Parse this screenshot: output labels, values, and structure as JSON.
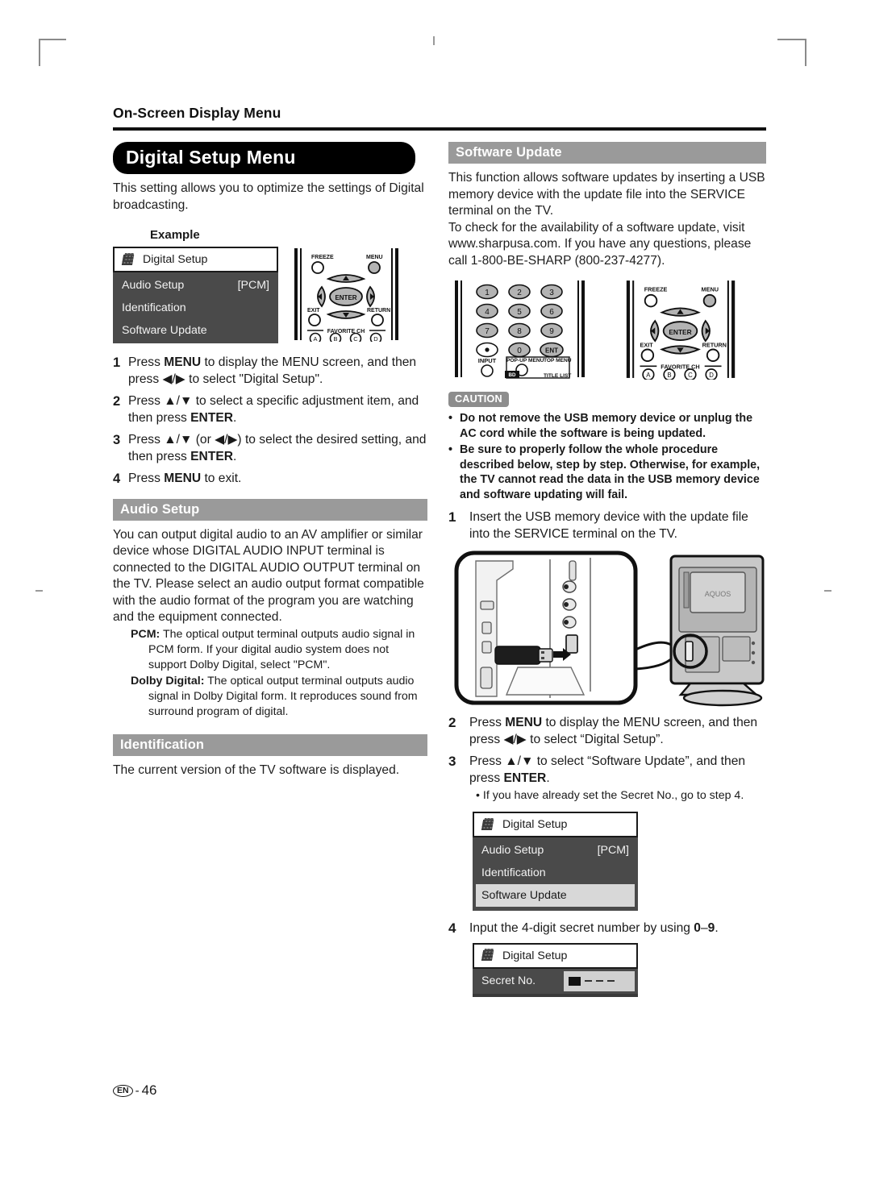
{
  "running_head": "On-Screen Display Menu",
  "page_title": "Digital Setup Menu",
  "intro": "This setting allows you to optimize the settings of Digital broadcasting.",
  "example_label": "Example",
  "osd_example": {
    "tab_label": "Digital Setup",
    "rows": [
      {
        "label": "Audio Setup",
        "value": "[PCM]"
      },
      {
        "label": "Identification",
        "value": ""
      },
      {
        "label": "Software Update",
        "value": ""
      }
    ]
  },
  "steps_left": [
    {
      "num": "1",
      "html": "Press <b>MENU</b> to display the MENU screen, and then press ◀/▶ to select \"Digital Setup\"."
    },
    {
      "num": "2",
      "html": "Press ▲/▼ to select a specific adjustment item, and then press <b>ENTER</b>."
    },
    {
      "num": "3",
      "html": "Press ▲/▼ (or ◀/▶) to select the desired setting, and then press <b>ENTER</b>."
    },
    {
      "num": "4",
      "html": "Press <b>MENU</b> to exit."
    }
  ],
  "audio_setup": {
    "heading": "Audio Setup",
    "body": "You can output digital audio to an AV amplifier or similar device whose DIGITAL AUDIO INPUT terminal is connected to the DIGITAL AUDIO OUTPUT terminal on the TV. Please select an audio output format compatible with the audio format of the program you are watching and the equipment connected.",
    "definitions": [
      {
        "term": "PCM:",
        "desc": "The optical output terminal outputs audio signal in PCM form. If your digital audio system does not support Dolby Digital, select \"PCM\"."
      },
      {
        "term": "Dolby Digital:",
        "desc": "The optical output terminal outputs audio signal in Dolby Digital form. It reproduces sound from surround program of digital."
      }
    ]
  },
  "identification": {
    "heading": "Identification",
    "body": "The current version of the TV software is displayed."
  },
  "software_update": {
    "heading": "Software Update",
    "body_1": "This function allows software updates by inserting a USB memory device with the update file into the SERVICE terminal on the TV.",
    "body_2": "To check for the availability of a software update, visit www.sharpusa.com. If you have any questions, please call 1-800-BE-SHARP (800-237-4277)."
  },
  "caution": {
    "tag": "CAUTION",
    "items": [
      "Do not remove the USB memory device or unplug the AC cord while the software is being updated.",
      "Be sure to properly follow the whole procedure described below, step by step. Otherwise, for example, the TV cannot read the data in the USB memory device and software updating will fail."
    ]
  },
  "steps_right": [
    {
      "num": "1",
      "html": "Insert the USB memory device with the update file into the SERVICE terminal on the TV."
    },
    {
      "num": "2",
      "html": "Press <b>MENU</b> to display the MENU screen, and then press ◀/▶ to select “Digital Setup”."
    },
    {
      "num": "3",
      "html": "Press ▲/▼ to select “Software Update”, and then press <b>ENTER</b>."
    },
    {
      "num": "4",
      "html": "Input the 4-digit secret number by using <b>0</b>–<b>9</b>."
    }
  ],
  "step3_note": "• If you have already set the Secret No., go to step 4.",
  "osd_update": {
    "tab_label": "Digital Setup",
    "rows": [
      {
        "label": "Audio Setup",
        "value": "[PCM]",
        "selected": false
      },
      {
        "label": "Identification",
        "value": "",
        "selected": false
      },
      {
        "label": "Software Update",
        "value": "",
        "selected": true
      }
    ]
  },
  "osd_secret": {
    "tab_label": "Digital Setup",
    "field_label": "Secret No.",
    "digits": "– – –"
  },
  "remote_numeric": {
    "keys": [
      "1",
      "2",
      "3",
      "4",
      "5",
      "6",
      "7",
      "8",
      "9"
    ],
    "dot_key": "●",
    "zero_key": "0",
    "ent_key": "ENT",
    "input_label": "INPUT",
    "popup_label": "POP-UP MENU",
    "topmenu_label": "TOP MENU",
    "bd_label": "BD",
    "titlelist_label": "TITLE LIST"
  },
  "remote_nav": {
    "freeze_label": "FREEZE",
    "menu_label": "MENU",
    "enter_label": "ENTER",
    "exit_label": "EXIT",
    "return_label": "RETURN",
    "favorite_label": "FAVORITE CH",
    "color_keys": [
      "A",
      "B",
      "C",
      "D"
    ],
    "up": "▲",
    "down": "▼",
    "left": "◀",
    "right": "▶"
  },
  "footer": {
    "lang": "EN",
    "sep": "-",
    "page": "46"
  },
  "colors": {
    "section_header_bg": "#9a9a9a",
    "title_pill_bg": "#000000",
    "osd_list_bg": "#4a4a4a",
    "osd_selected_bg": "#d8d8d8",
    "caution_tag_bg": "#8d8d8d"
  }
}
